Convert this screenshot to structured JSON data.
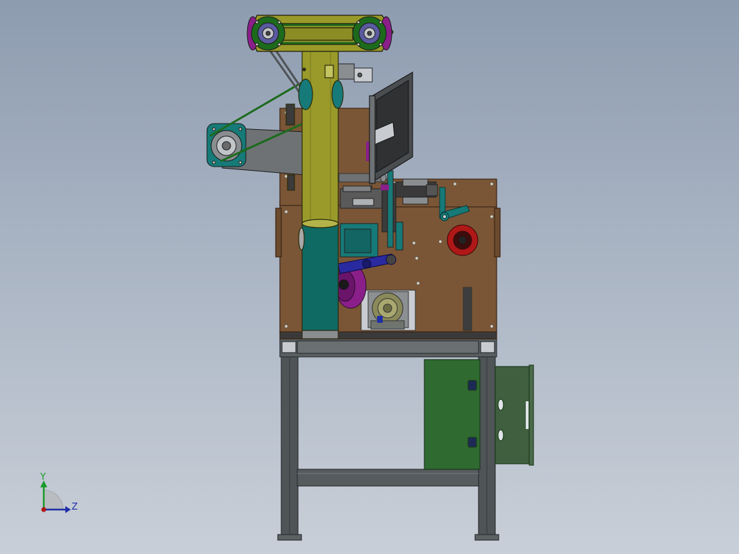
{
  "viewport": {
    "background_top": "#8e9cb0",
    "background_bottom": "#c9cfd8"
  },
  "triad": {
    "y_label": "Y",
    "z_label": "Z",
    "y_color": "#1a9a2a",
    "z_color": "#1e2fa8",
    "origin_color": "#b01818"
  },
  "colors": {
    "frame": "#4f5457",
    "frame_edge": "#2d3133",
    "base_plate": "#7a5636",
    "column": "#9a9a2a",
    "column_lower": "#0f6a64",
    "teal_part": "#167a78",
    "belt": "#1d6a1d",
    "magenta": "#8a1f8a",
    "red_wheel": "#b01818",
    "cabinet": "#2f6a30",
    "cabinet_side": "#3f5f3f"
  }
}
